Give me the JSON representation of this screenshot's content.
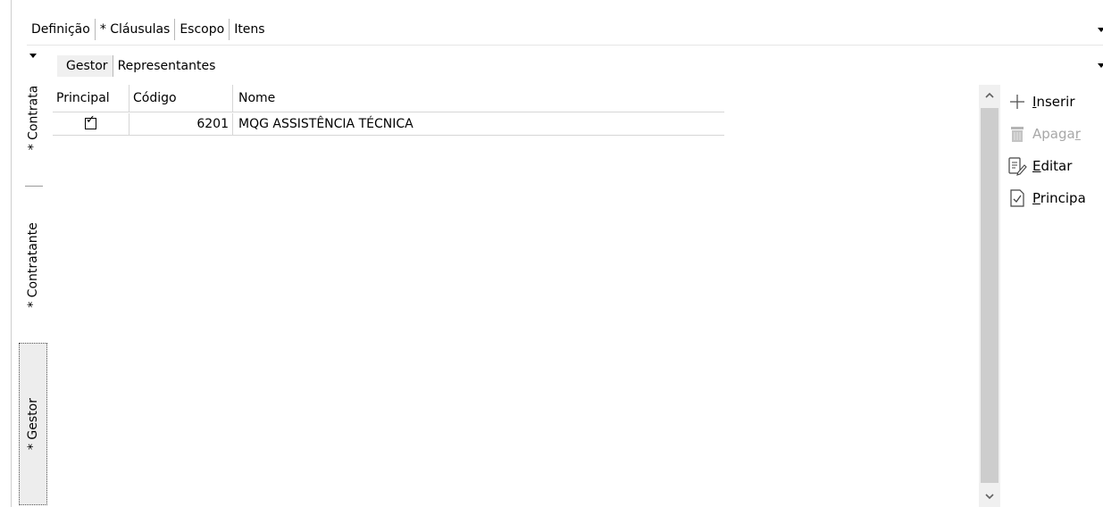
{
  "top_tabs": [
    {
      "label": "Definição"
    },
    {
      "label": "* Cláusulas"
    },
    {
      "label": "Escopo"
    },
    {
      "label": "Itens"
    }
  ],
  "left_tabs": [
    {
      "label": "* Contrata"
    },
    {
      "label": "* Contratante"
    },
    {
      "label": "* Gestor"
    }
  ],
  "sub_tabs": [
    {
      "label": "Gestor"
    },
    {
      "label": "Representantes"
    }
  ],
  "grid": {
    "columns": [
      "Principal",
      "Código",
      "Nome"
    ],
    "rows": [
      {
        "principal": true,
        "codigo": "6201",
        "nome": "MQG ASSISTÊNCIA TÉCNICA"
      }
    ]
  },
  "actions": {
    "inserir": {
      "pre": "",
      "u": "I",
      "post": "nserir",
      "icon": "plus-icon"
    },
    "apagar": {
      "pre": "Apaga",
      "u": "r",
      "post": "",
      "icon": "trash-icon"
    },
    "editar": {
      "pre": "",
      "u": "E",
      "post": "ditar",
      "icon": "edit-icon"
    },
    "principal": {
      "pre": "",
      "u": "P",
      "post": "rincipa",
      "icon": "checked-page-icon"
    }
  }
}
